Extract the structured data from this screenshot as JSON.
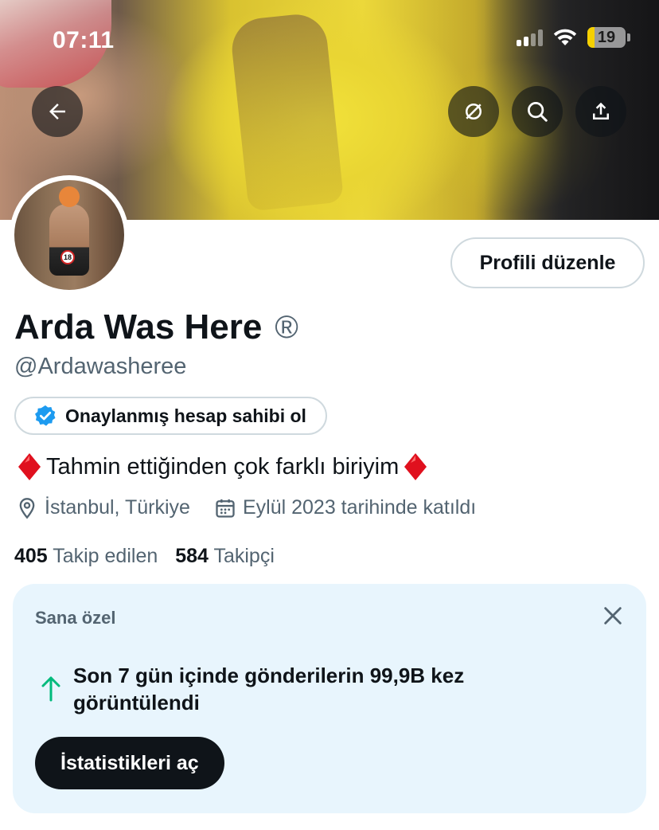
{
  "status_bar": {
    "time": "07:11",
    "battery": "19",
    "battery_fraction": 0.19,
    "battery_color": "#f5d000"
  },
  "header": {
    "back_icon": "arrow-left-icon",
    "hide_icon": "eye-slash-icon",
    "search_icon": "search-icon",
    "share_icon": "share-icon"
  },
  "profile": {
    "edit_button": "Profili düzenle",
    "name": "Arda Was Here",
    "name_suffix": "®",
    "handle": "@Ardawasheree",
    "verify_label": "Onaylanmış hesap sahibi ol",
    "bio": "Tahmin ettiğinden çok farklı biriyim",
    "location": "İstanbul, Türkiye",
    "joined": "Eylül 2023 tarihinde katıldı",
    "following_count": "405",
    "following_label": "Takip edilen",
    "followers_count": "584",
    "followers_label": "Takipçi"
  },
  "card": {
    "title": "Sana özel",
    "message": "Son 7 gün içinde gönderilerin 99,9B kez görüntülendi",
    "button": "İstatistikleri aç"
  },
  "colors": {
    "accent": "#1d9bf0",
    "text_primary": "#0f1419",
    "text_secondary": "#536471",
    "card_bg": "#e8f5fd",
    "trend_green": "#00ba7c",
    "diamond_red": "#e0101e"
  }
}
